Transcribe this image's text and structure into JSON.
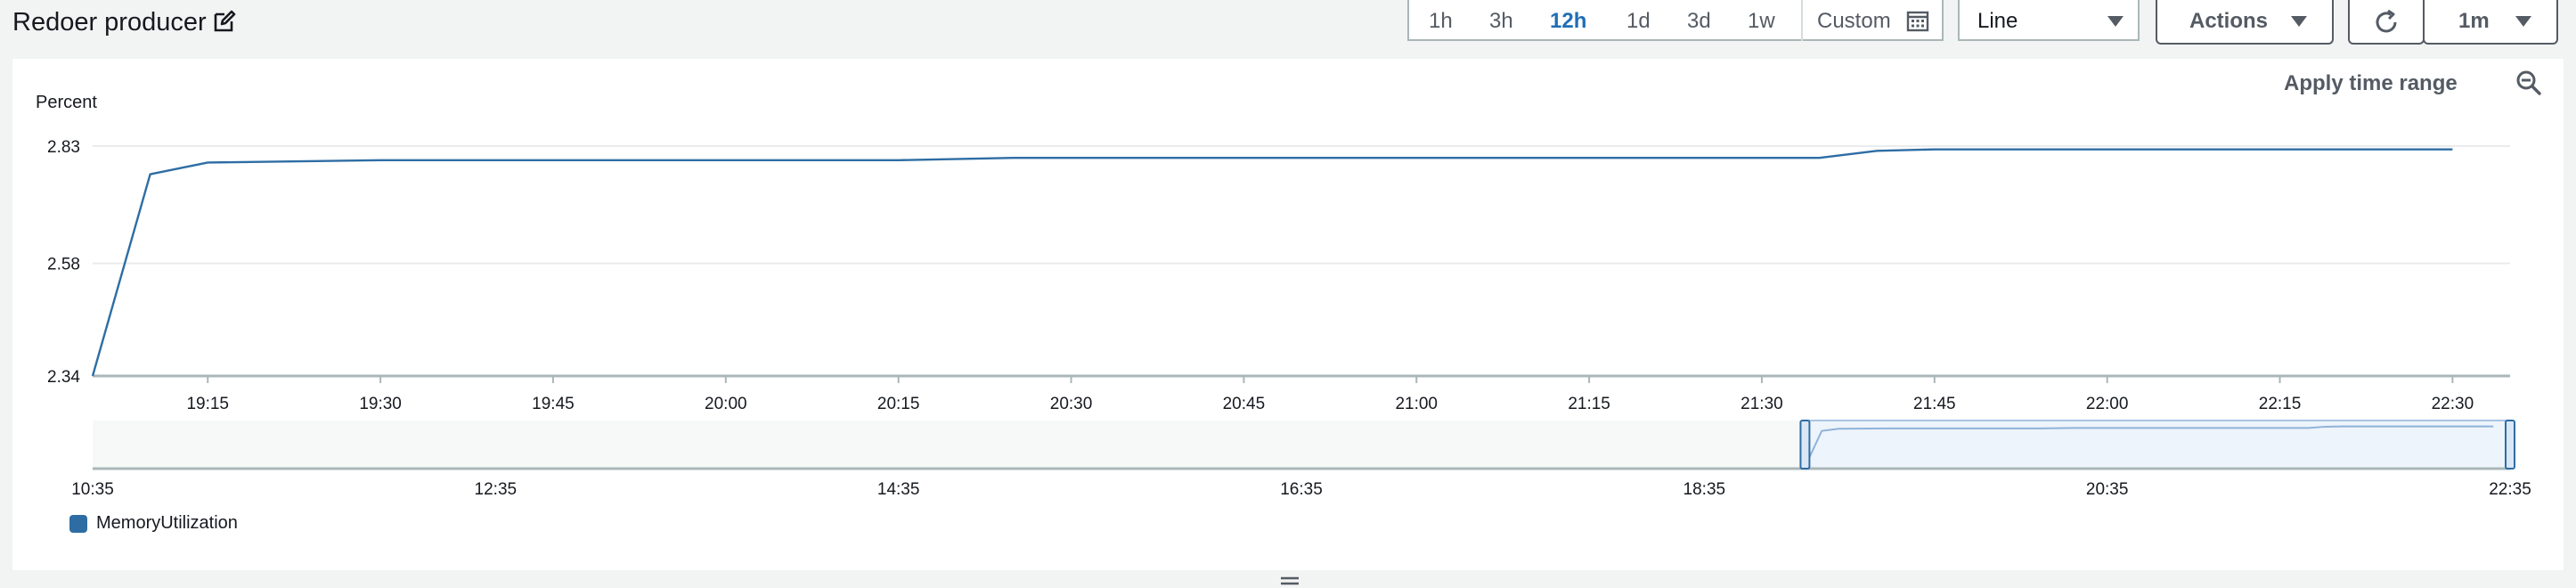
{
  "header": {
    "title": "Redoer producer",
    "time_ranges": [
      "1h",
      "3h",
      "12h",
      "1d",
      "3d",
      "1w"
    ],
    "selected_range": "12h",
    "custom_label": "Custom",
    "view_select": "Line",
    "actions_label": "Actions",
    "refresh_interval": "1m"
  },
  "panel": {
    "apply_time_range_label": "Apply time range"
  },
  "colors": {
    "series": "#2e6da4",
    "selected_range": "#1f6fb5"
  },
  "chart_data": {
    "type": "line",
    "ylabel": "Percent",
    "ylim": [
      2.34,
      2.83
    ],
    "yticks": [
      "2.83",
      "2.58",
      "2.34"
    ],
    "xticks": [
      "19:15",
      "19:30",
      "19:45",
      "20:00",
      "20:15",
      "20:30",
      "20:45",
      "21:00",
      "21:15",
      "21:30",
      "21:45",
      "22:00",
      "22:15",
      "22:30"
    ],
    "series": [
      {
        "name": "MemoryUtilization",
        "x": [
          "19:05",
          "19:10",
          "19:15",
          "19:30",
          "20:15",
          "20:25",
          "21:35",
          "21:40",
          "21:45",
          "22:30"
        ],
        "y": [
          2.34,
          2.77,
          2.795,
          2.8,
          2.8,
          2.805,
          2.805,
          2.82,
          2.823,
          2.823
        ]
      }
    ],
    "navigator": {
      "xticks": [
        "10:35",
        "12:35",
        "14:35",
        "16:35",
        "18:35",
        "20:35",
        "22:35"
      ],
      "selection": [
        "19:05",
        "22:35"
      ]
    }
  }
}
